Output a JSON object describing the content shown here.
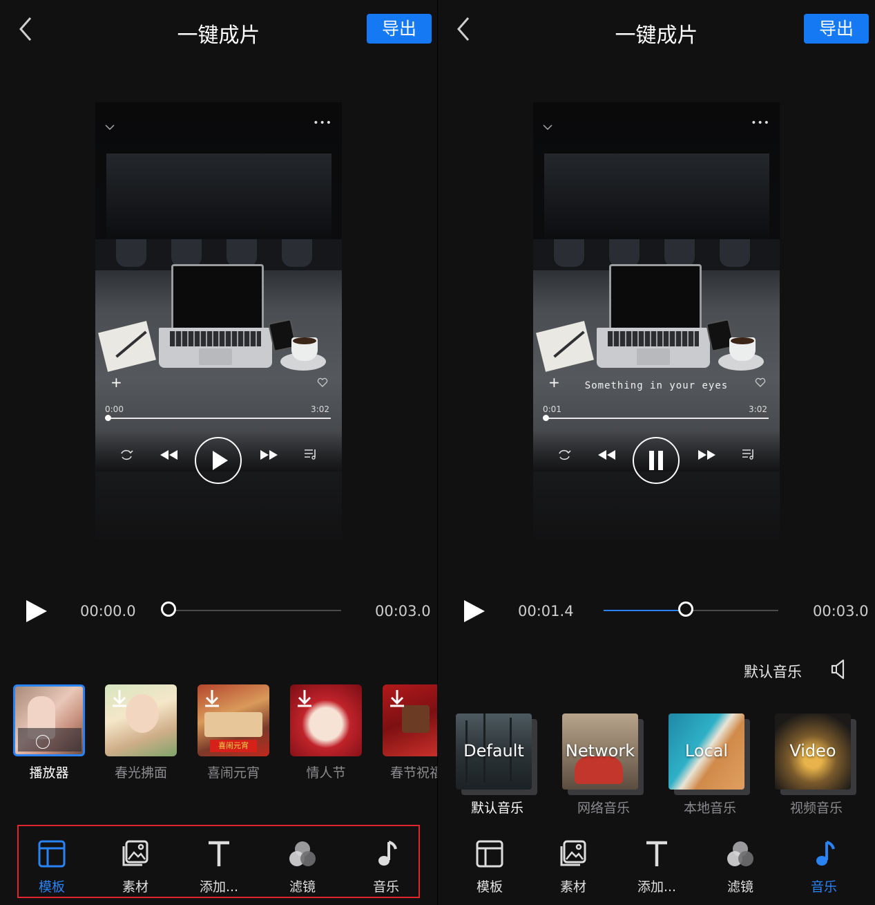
{
  "left": {
    "title": "一键成片",
    "export_label": "导出",
    "preview": {
      "song_title": "",
      "current_time": "0:00",
      "total_time": "3:02",
      "playing": false
    },
    "timeline": {
      "current": "00:00.0",
      "total": "00:03.0",
      "progress": 0.0
    },
    "templates": [
      {
        "label": "播放器",
        "selected": true
      },
      {
        "label": "春光拂面",
        "selected": false
      },
      {
        "label": "喜闹元宵",
        "selected": false
      },
      {
        "label": "情人节",
        "selected": false
      },
      {
        "label": "春节祝福",
        "selected": false
      }
    ],
    "nav": [
      {
        "label": "模板",
        "icon": "template-icon",
        "active": true
      },
      {
        "label": "素材",
        "icon": "gallery-icon",
        "active": false
      },
      {
        "label": "添加...",
        "icon": "text-icon",
        "active": false
      },
      {
        "label": "滤镜",
        "icon": "filter-icon",
        "active": false
      },
      {
        "label": "音乐",
        "icon": "music-note-icon",
        "active": false
      }
    ]
  },
  "right": {
    "title": "一键成片",
    "export_label": "导出",
    "preview": {
      "song_title": "Something in your eyes",
      "current_time": "0:01",
      "total_time": "3:02",
      "playing": true
    },
    "timeline": {
      "current": "00:01.4",
      "total": "00:03.0",
      "progress": 0.47
    },
    "music_header": "默认音乐",
    "music": [
      {
        "word": "Default",
        "label": "默认音乐",
        "active": true
      },
      {
        "word": "Network",
        "label": "网络音乐",
        "active": false
      },
      {
        "word": "Local",
        "label": "本地音乐",
        "active": false
      },
      {
        "word": "Video",
        "label": "视频音乐",
        "active": false
      }
    ],
    "nav": [
      {
        "label": "模板",
        "icon": "template-icon",
        "active": false
      },
      {
        "label": "素材",
        "icon": "gallery-icon",
        "active": false
      },
      {
        "label": "添加...",
        "icon": "text-icon",
        "active": false
      },
      {
        "label": "滤镜",
        "icon": "filter-icon",
        "active": false
      },
      {
        "label": "音乐",
        "icon": "music-note-icon",
        "active": true
      }
    ]
  },
  "colors": {
    "accent": "#2a83f5",
    "export_button": "#1479f3",
    "highlight_box": "#e0262b",
    "background": "#111112"
  }
}
